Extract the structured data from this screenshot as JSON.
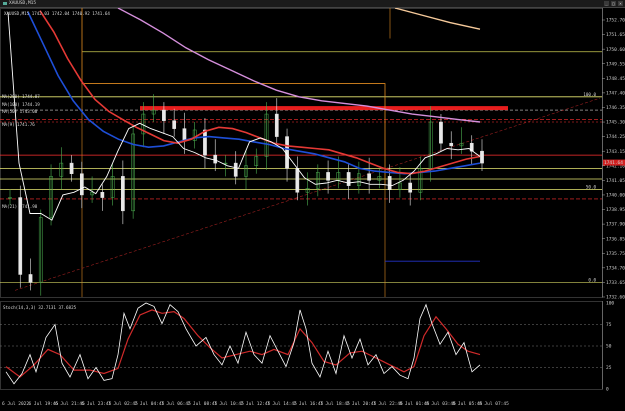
{
  "window": {
    "tab_label": "XAUUSD,M15",
    "min_label": "_",
    "max_label": "□",
    "close_label": "×"
  },
  "chart": {
    "symbol_header": "XAUUSD,M15  1742.03 1742.04 1740.92 1741.64",
    "indicator_labels": [
      "MA(200) 1744.87",
      "MA(100) 1744.19",
      "MA(50) 1743.00",
      "MA(21) 1741.98",
      "MA(9) 1741.76"
    ],
    "fib_label_top": "100.0",
    "fib_label_mid": "50.0",
    "fib_label_bottom": "0.0",
    "current_price": "1741.64",
    "price_ticks": [
      "1752.70",
      "1751.65",
      "1750.60",
      "1749.55",
      "1748.45",
      "1747.40",
      "1746.35",
      "1745.30",
      "1744.25",
      "1743.15",
      "1742.10",
      "1741.05",
      "1740.00",
      "1738.95",
      "1737.90",
      "1736.85",
      "1735.75",
      "1734.70",
      "1733.65",
      "1732.60"
    ],
    "time_ticks": [
      "6 Jul 2022",
      "6 Jul 19:45",
      "6 Jul 21:45",
      "6 Jul 23:45",
      "7 Jul 02:45",
      "7 Jul 04:45",
      "7 Jul 06:45",
      "7 Jul 08:45",
      "7 Jul 10:45",
      "7 Jul 12:45",
      "7 Jul 14:45",
      "7 Jul 16:45",
      "7 Jul 18:45",
      "7 Jul 20:45",
      "7 Jul 22:45",
      "8 Jul 01:45",
      "8 Jul 03:45",
      "8 Jul 05:45",
      "8 Jul 07:45"
    ]
  },
  "oscillator": {
    "header": "Stoch(14,3,3) 32.7131 37.6825",
    "level_ticks": [
      "100",
      "75",
      "50",
      "25",
      "0"
    ]
  },
  "chart_data": {
    "type": "line",
    "title": "XAUUSD,M15",
    "ylim": [
      1731.5,
      1753.3
    ],
    "colors": {
      "bull": "#4caf50",
      "bear": "#e8e8e8",
      "ma_fast": "#ffffff",
      "ma_red": "#e53935",
      "ma_blue": "#1e4fd8",
      "ma_violet": "#d58fdc",
      "ma_slow": "#f5c99a",
      "level": "#e0e06a",
      "resistance": "#ff2020"
    },
    "series": [
      {
        "name": "Close",
        "values": [
          1739.0,
          1733.2,
          1732.6,
          1737.5,
          1740.6,
          1741.6,
          1740.8,
          1739.2,
          1739.4,
          1739.0,
          1740.6,
          1738.0,
          1743.8,
          1745.3,
          1745.6,
          1744.8,
          1744.2,
          1743.3,
          1744.1,
          1742.2,
          1741.6,
          1741.6,
          1740.6,
          1741.4,
          1742.1,
          1745.3,
          1743.6,
          1741.2,
          1739.4,
          1739.7,
          1740.9,
          1740.3,
          1740.9,
          1739.9,
          1740.8,
          1740.3,
          1740.6,
          1739.6,
          1740.1,
          1739.4,
          1741.2,
          1744.7,
          1743.1,
          1742.9,
          1743.1,
          1742.5,
          1741.6
        ]
      },
      {
        "name": "MA fast",
        "values": [
          1753.0,
          1741.6,
          1737.8,
          1737.8,
          1737.3,
          1739.2,
          1739.4,
          1739.8,
          1739.3,
          1740.6,
          1742.5,
          1744.2,
          1744.6,
          1744.2,
          1743.9,
          1743.6,
          1742.7,
          1742.4,
          1742.0,
          1741.8,
          1741.4,
          1741.2,
          1743.2,
          1743.5,
          1743.2,
          1742.7,
          1741.6,
          1740.5,
          1740.0,
          1740.1,
          1740.3,
          1740.1,
          1740.2,
          1740.0,
          1740.0,
          1739.9,
          1740.3,
          1741.0,
          1742.0,
          1742.3,
          1742.7,
          1742.6,
          1742.7,
          1742.1
        ]
      },
      {
        "name": "MA red",
        "values": [
          1753.1,
          1751.5,
          1749.5,
          1747.8,
          1746.4,
          1745.5,
          1744.9,
          1744.3,
          1743.8,
          1743.3,
          1743.1,
          1743.4,
          1744.0,
          1744.3,
          1744.2,
          1743.9,
          1743.5,
          1743.1,
          1742.9,
          1742.8,
          1742.7,
          1742.6,
          1742.3,
          1742.0,
          1741.6,
          1741.2,
          1740.9,
          1740.8,
          1741.0,
          1741.3,
          1741.6,
          1741.9,
          1742.1
        ]
      },
      {
        "name": "MA blue",
        "values": [
          1753.0,
          1750.6,
          1748.2,
          1746.3,
          1744.9,
          1744.0,
          1743.4,
          1743.0,
          1742.8,
          1742.9,
          1743.2,
          1743.5,
          1743.6,
          1743.5,
          1743.4,
          1743.2,
          1743.0,
          1742.7,
          1742.5,
          1742.3,
          1742.0,
          1741.7,
          1741.2,
          1741.0,
          1740.9,
          1740.8,
          1740.9,
          1741.0,
          1741.2,
          1741.4,
          1741.6
        ]
      },
      {
        "name": "MA violet",
        "values": [
          1753.3,
          1752.4,
          1751.4,
          1750.3,
          1749.4,
          1748.6,
          1747.8,
          1747.1,
          1746.6,
          1746.3,
          1746.1,
          1745.9,
          1745.6,
          1745.3,
          1745.1,
          1744.9,
          1744.7
        ]
      }
    ]
  }
}
